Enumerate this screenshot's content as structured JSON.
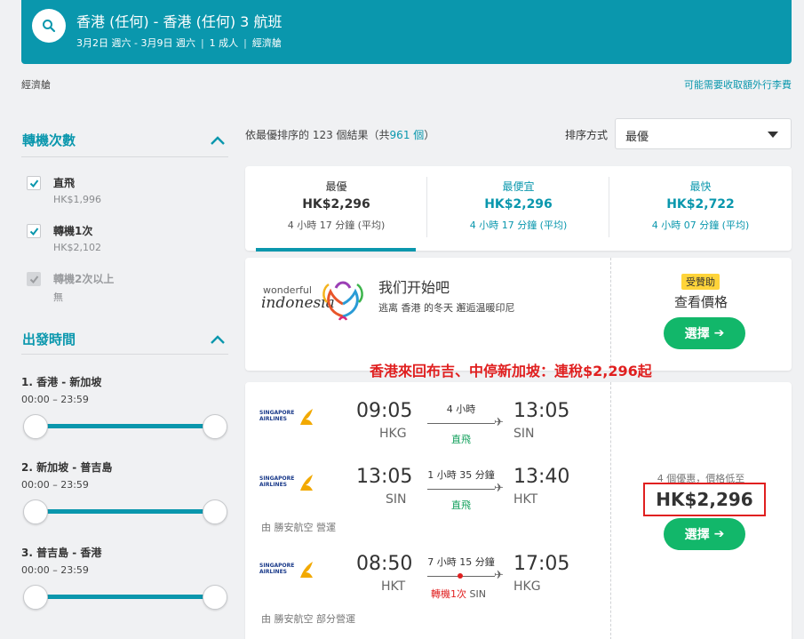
{
  "header": {
    "title": "香港 (任何) - 香港 (任何) 3 航班",
    "dates": "3月2日 週六 - 3月9日 週六",
    "passengers": "1 成人",
    "cabin": "經濟艙"
  },
  "cabin_label": "經濟艙",
  "fee_link": "可能需要收取額外行李費",
  "sidebar": {
    "stops_title": "轉機次數",
    "stops": [
      {
        "label": "直飛",
        "price": "HK$1,996"
      },
      {
        "label": "轉機1次",
        "price": "HK$2,102"
      },
      {
        "label": "轉機2次以上",
        "price": "無"
      }
    ],
    "departure_title": "出發時間",
    "legs": [
      {
        "title": "1. 香港 - 新加坡",
        "range": "00:00 – 23:59"
      },
      {
        "title": "2. 新加坡 - 普吉島",
        "range": "00:00 – 23:59"
      },
      {
        "title": "3. 普吉島 - 香港",
        "range": "00:00 – 23:59"
      }
    ]
  },
  "results": {
    "prefix": "依最優排序的 123 個結果（共",
    "total": "961 個",
    "suffix": "）",
    "sort_label": "排序方式",
    "sort_value": "最優"
  },
  "tabs": [
    {
      "label": "最優",
      "price": "HK$2,296",
      "duration": "4 小時 17 分鐘 (平均)"
    },
    {
      "label": "最便宜",
      "price": "HK$2,296",
      "duration": "4 小時 17 分鐘 (平均)"
    },
    {
      "label": "最快",
      "price": "HK$2,722",
      "duration": "4 小時 07 分鐘 (平均)"
    }
  ],
  "ad": {
    "logo_line1": "wonderful",
    "logo_line2": "indonesia",
    "title": "我们开始吧",
    "desc": "逃离 香港 的冬天 邂逅温暖印尼",
    "badge": "受贊助",
    "view_price": "查看價格",
    "button": "選擇"
  },
  "annotation": "香港來回布吉、中停新加坡：連稅$2,296起",
  "flight": {
    "airline_line1": "SINGAPORE",
    "airline_line2": "AIRLINES",
    "legs": [
      {
        "dep": "09:05",
        "dep_code": "HKG",
        "arr": "13:05",
        "arr_code": "SIN",
        "duration": "4 小時",
        "stop": "直飛"
      },
      {
        "dep": "13:05",
        "dep_code": "SIN",
        "arr": "13:40",
        "arr_code": "HKT",
        "duration": "1 小時 35 分鐘",
        "stop": "直飛"
      },
      {
        "dep": "08:50",
        "dep_code": "HKT",
        "arr": "17:05",
        "arr_code": "HKG",
        "duration": "7 小時 15 分鐘",
        "stop": "轉機1次",
        "stop_via": "SIN"
      }
    ],
    "operated_1": "由 勝安航空 營運",
    "operated_2": "由 勝安航空 部分營運",
    "deals": "4 個優惠，價格低至",
    "price": "HK$2,296",
    "button": "選擇"
  }
}
